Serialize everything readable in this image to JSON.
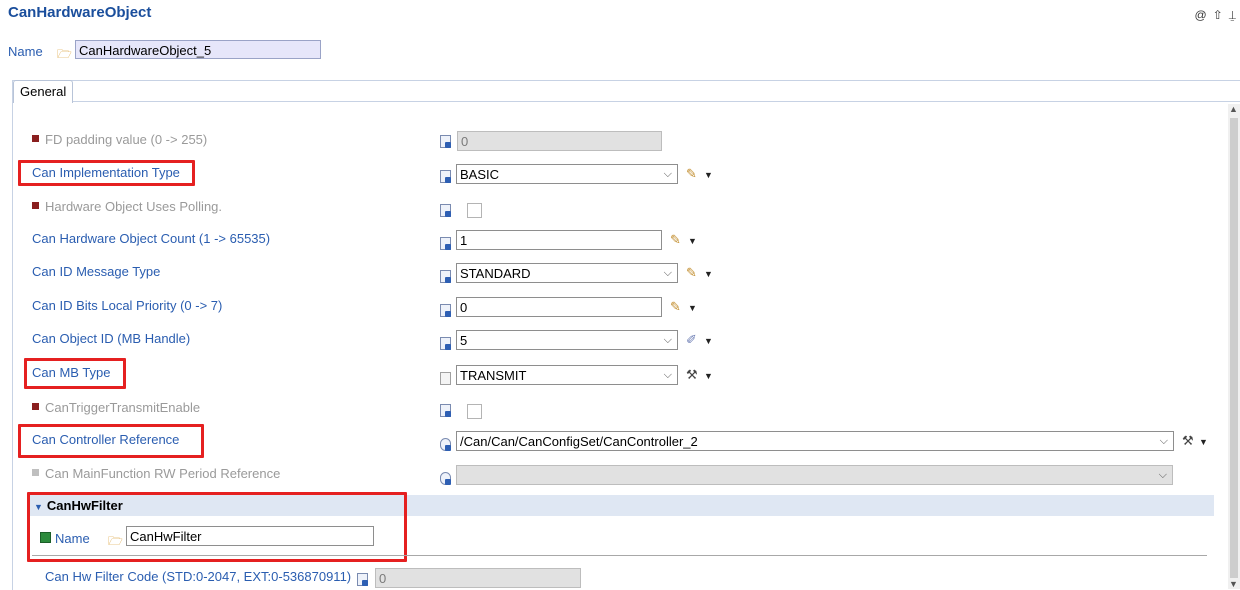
{
  "header": {
    "title": "CanHardwareObject",
    "name_label": "Name",
    "name_value": "CanHardwareObject_5",
    "icons": [
      "at-icon",
      "up-arrow-icon",
      "pin-icon"
    ]
  },
  "tabs": [
    {
      "label": "General",
      "active": true
    }
  ],
  "rows": [
    {
      "label": "FD padding value (0 -> 255)",
      "value": "0",
      "enabled": false
    },
    {
      "label": "Can Implementation Type",
      "value": "BASIC"
    },
    {
      "label": "Hardware Object Uses Polling.",
      "enabled": false
    },
    {
      "label": "Can Hardware Object Count (1 -> 65535)",
      "value": "1"
    },
    {
      "label": "Can ID Message Type",
      "value": "STANDARD"
    },
    {
      "label": "Can ID Bits Local Priority (0 -> 7)",
      "value": "0"
    },
    {
      "label": "Can Object ID (MB Handle)",
      "value": "5"
    },
    {
      "label": "Can MB Type",
      "value": "TRANSMIT"
    },
    {
      "label": "CanTriggerTransmitEnable",
      "enabled": false
    },
    {
      "label": "Can Controller Reference",
      "value": "/Can/Can/CanConfigSet/CanController_2"
    },
    {
      "label": "Can MainFunction RW Period Reference",
      "value": "",
      "enabled": false
    }
  ],
  "section": {
    "title": "CanHwFilter",
    "name_label": "Name",
    "name_value": "CanHwFilter",
    "filter_label": "Can Hw Filter Code (STD:0-2047, EXT:0-536870911)",
    "filter_value": "0"
  },
  "colors": {
    "highlight": "#e52020",
    "link": "#2a5db0",
    "disabled_bullet": "#8a1f1f"
  }
}
